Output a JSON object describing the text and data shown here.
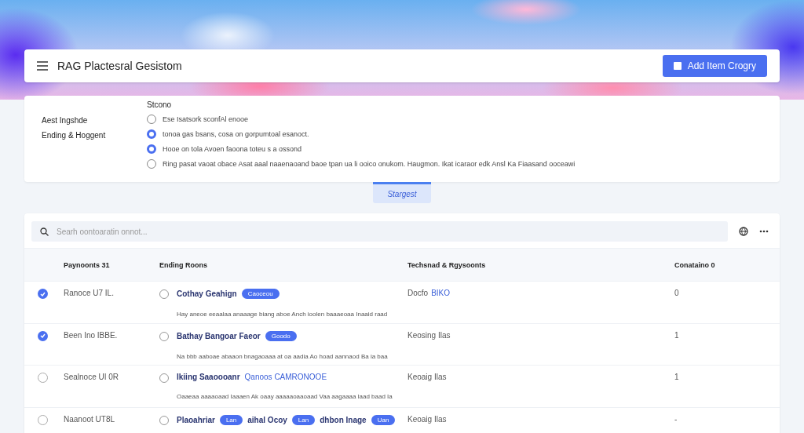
{
  "header": {
    "title": "RAG Plactesral Gesistom",
    "action": "Add Item Crogry"
  },
  "filters": {
    "labels": [
      "Aest Ingshde",
      "Ending & Hoggent"
    ],
    "group_title": "Stcono",
    "options": [
      {
        "label": "Ese Isatsork sconfAl enooe",
        "selected": false
      },
      {
        "label": "tonoa gas bsans, cosa on gorpumtoal esanoct.",
        "selected": true
      },
      {
        "label": "Hooe on tola Avoen faoona toteu s a ossond",
        "selected": true
      },
      {
        "label": "Ring pasat vaoat obace Asat aaal naaenaoand baoe tpan ua li ooico onukom. Haugmon. Ikat icaraor edk Ansl Ka Fiaasand ooceawi",
        "selected": false
      }
    ]
  },
  "tab": {
    "label": "Stargest",
    "selected": true
  },
  "search": {
    "placeholder": "Searh oontoaratin onnot..."
  },
  "table": {
    "columns": [
      "Paynoonts 31",
      "Ending Roons",
      "Techsnad & Rgysoonts",
      "Conataino 0"
    ],
    "rows": [
      {
        "checked": true,
        "selected": false,
        "id": "Ranoce U7 IL.",
        "segments": [
          {
            "kind": "text",
            "text": "Cothay Geahign"
          },
          {
            "kind": "tag",
            "text": "Caoceou"
          }
        ],
        "description": "Hay aneoe eeaalaa anaaage biang aboe Anch ioolen baaaeoaa Inaaid raad",
        "type": [
          {
            "kind": "text",
            "text": "Docfo"
          },
          {
            "kind": "link",
            "text": "BIKO"
          }
        ],
        "count": "0"
      },
      {
        "checked": true,
        "selected": false,
        "id": "Been Ino IBBE.",
        "segments": [
          {
            "kind": "text",
            "text": "Bathay Bangoar Faeor"
          },
          {
            "kind": "tag",
            "text": "Goodo"
          }
        ],
        "description": "Na bbb aaboae abaaon bnagaoaaa at oa aadia Ao hoad aannaod Ba ia baa",
        "type": [
          {
            "kind": "text",
            "text": "Keosing Ilas"
          }
        ],
        "count": "1"
      },
      {
        "checked": false,
        "selected": false,
        "id": "Sealnoce UI 0R",
        "segments": [
          {
            "kind": "text",
            "text": "Ikiing Saaoooanr"
          },
          {
            "kind": "link",
            "text": "Qanoos CAMRONOOE"
          }
        ],
        "description": "Oaaeaa aaaaoaad Iaaaen Ak oaay aaaaaoaaoaad Vaa aagaaaa laad baad Ia",
        "type": [
          {
            "kind": "text",
            "text": "Keoaig Ilas"
          }
        ],
        "count": "1"
      },
      {
        "checked": false,
        "selected": false,
        "id": "Naanoot UT8L",
        "segments": [
          {
            "kind": "text",
            "text": "Plaoahriar"
          },
          {
            "kind": "tag",
            "text": "Lan"
          },
          {
            "kind": "text",
            "text": "aihal Ocoy"
          },
          {
            "kind": "tag",
            "text": "Lan"
          },
          {
            "kind": "text",
            "text": "dhbon Inage"
          },
          {
            "kind": "tag",
            "text": "Uan"
          }
        ],
        "type": [
          {
            "kind": "text",
            "text": "Keoaig Ilas"
          }
        ],
        "count": "-"
      }
    ]
  }
}
